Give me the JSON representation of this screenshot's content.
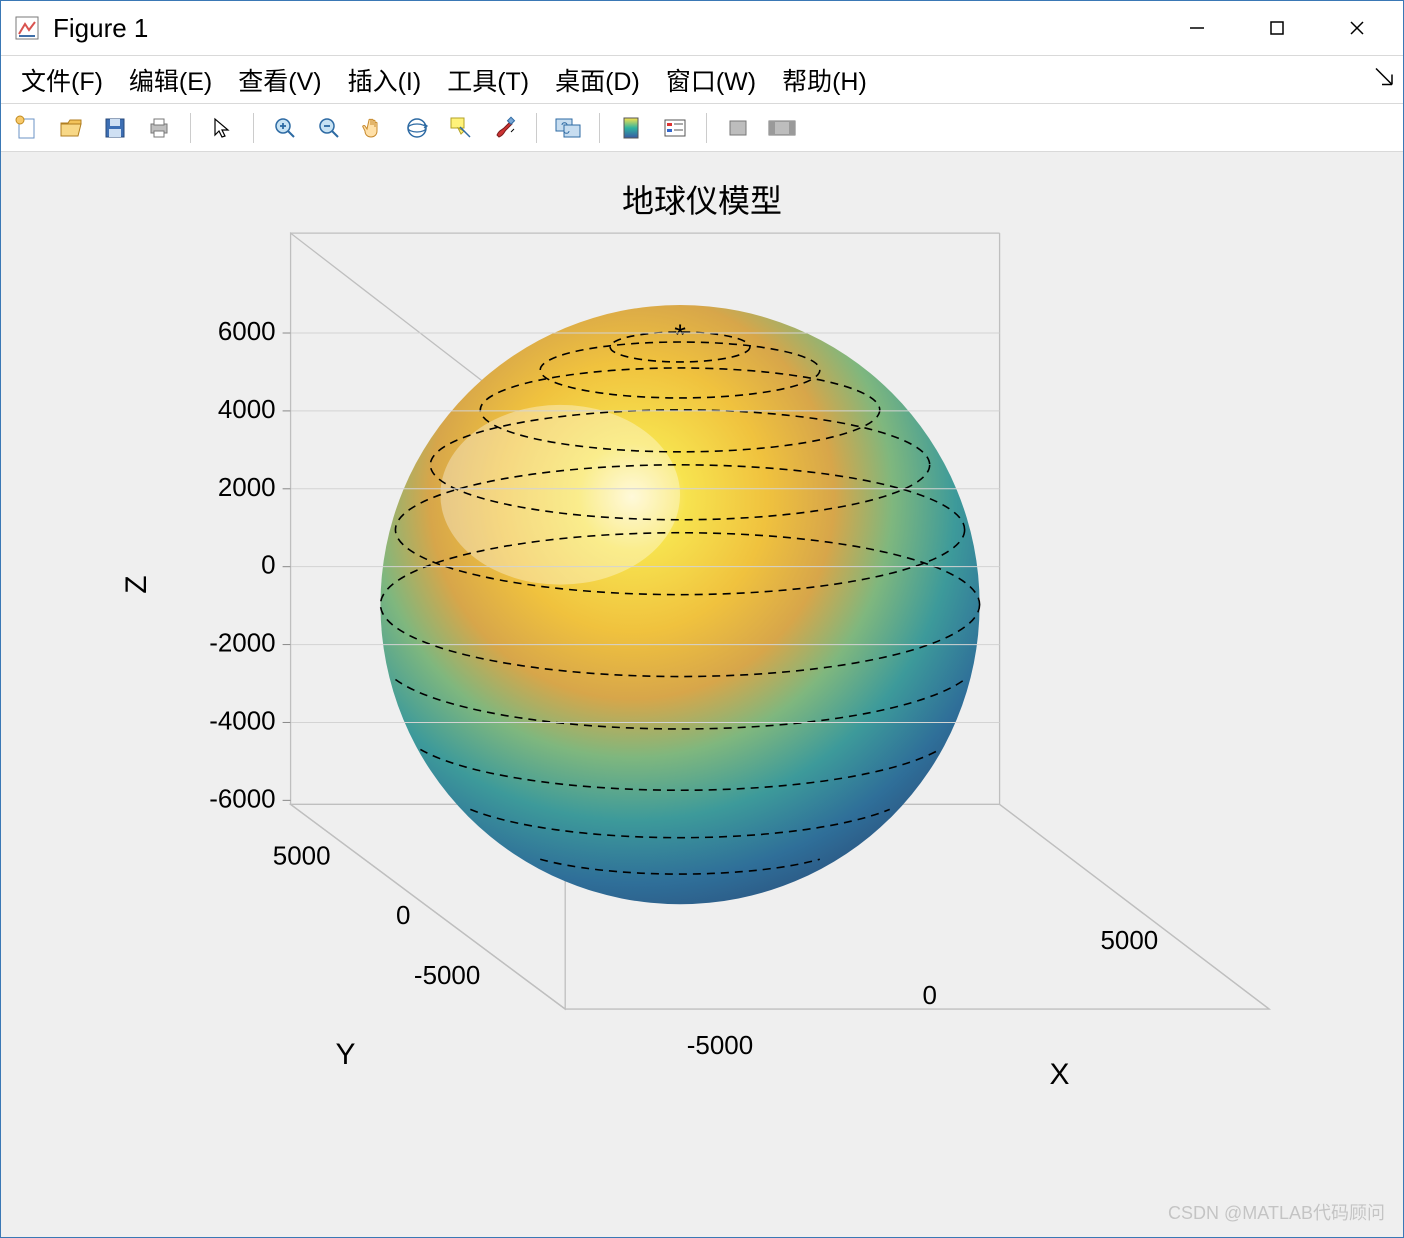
{
  "window": {
    "title": "Figure 1",
    "minimize_tooltip": "Minimize",
    "maximize_tooltip": "Maximize",
    "close_tooltip": "Close"
  },
  "menu": {
    "file": "文件(F)",
    "edit": "编辑(E)",
    "view": "查看(V)",
    "insert": "插入(I)",
    "tools": "工具(T)",
    "desktop": "桌面(D)",
    "window": "窗口(W)",
    "help": "帮助(H)"
  },
  "toolbar": {
    "new": "New Figure",
    "open": "Open",
    "save": "Save",
    "print": "Print",
    "pointer": "Edit Plot",
    "zoom_in": "Zoom In",
    "zoom_out": "Zoom Out",
    "pan": "Pan",
    "rotate3d": "Rotate 3D",
    "datatip": "Data Cursor",
    "brush": "Brush",
    "link": "Link Plot",
    "colorbar": "Insert Colorbar",
    "legend": "Insert Legend",
    "hide": "Hide Plot Tools",
    "show": "Show Plot Tools"
  },
  "plot": {
    "title": "地球仪模型",
    "xlabel": "X",
    "ylabel": "Y",
    "zlabel": "Z"
  },
  "watermark": "CSDN @MATLAB代码顾问",
  "chart_data": {
    "type": "surface",
    "title": "地球仪模型",
    "description": "3-D shaded sphere (globe model) of approximate radius 6378 rendered with a parula-like colormap (blue at bottom through green to yellow at top), dashed latitude contour lines, and a star marker at the top pole.",
    "radius": 6378,
    "xlabel": "X",
    "ylabel": "Y",
    "zlabel": "Z",
    "x_ticks": [
      -5000,
      0,
      5000
    ],
    "y_ticks": [
      -5000,
      5000
    ],
    "z_ticks": [
      -6000,
      -4000,
      -2000,
      0,
      2000,
      4000,
      6000
    ],
    "xlim": [
      -6378,
      6378
    ],
    "ylim": [
      -6378,
      6378
    ],
    "zlim": [
      -6378,
      6378
    ],
    "colormap": "parula",
    "latitude_line_style": "dashed",
    "pole_marker": "*"
  }
}
